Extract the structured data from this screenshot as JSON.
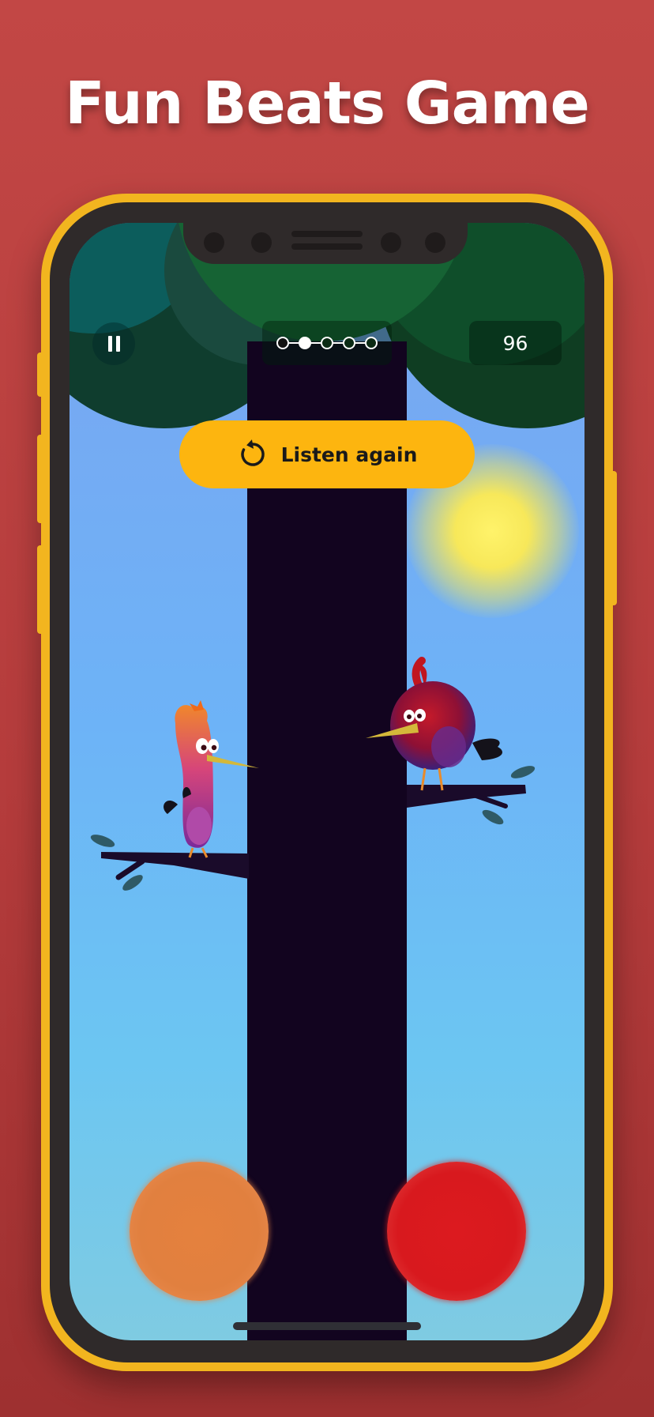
{
  "headline": "Fun Beats Game",
  "hud": {
    "score": "96",
    "progress": {
      "total_steps": 5,
      "current_step": 2
    }
  },
  "listen_again": {
    "label": "Listen again"
  },
  "colors": {
    "background": "#b53c3c",
    "phone_frame": "#f2b51f",
    "button": "#fdb50f",
    "pad_left": "#e1803f",
    "pad_right": "#d8191e",
    "trunk": "#12041f"
  },
  "icons": {
    "pause": "pause-icon",
    "replay": "replay-icon"
  }
}
